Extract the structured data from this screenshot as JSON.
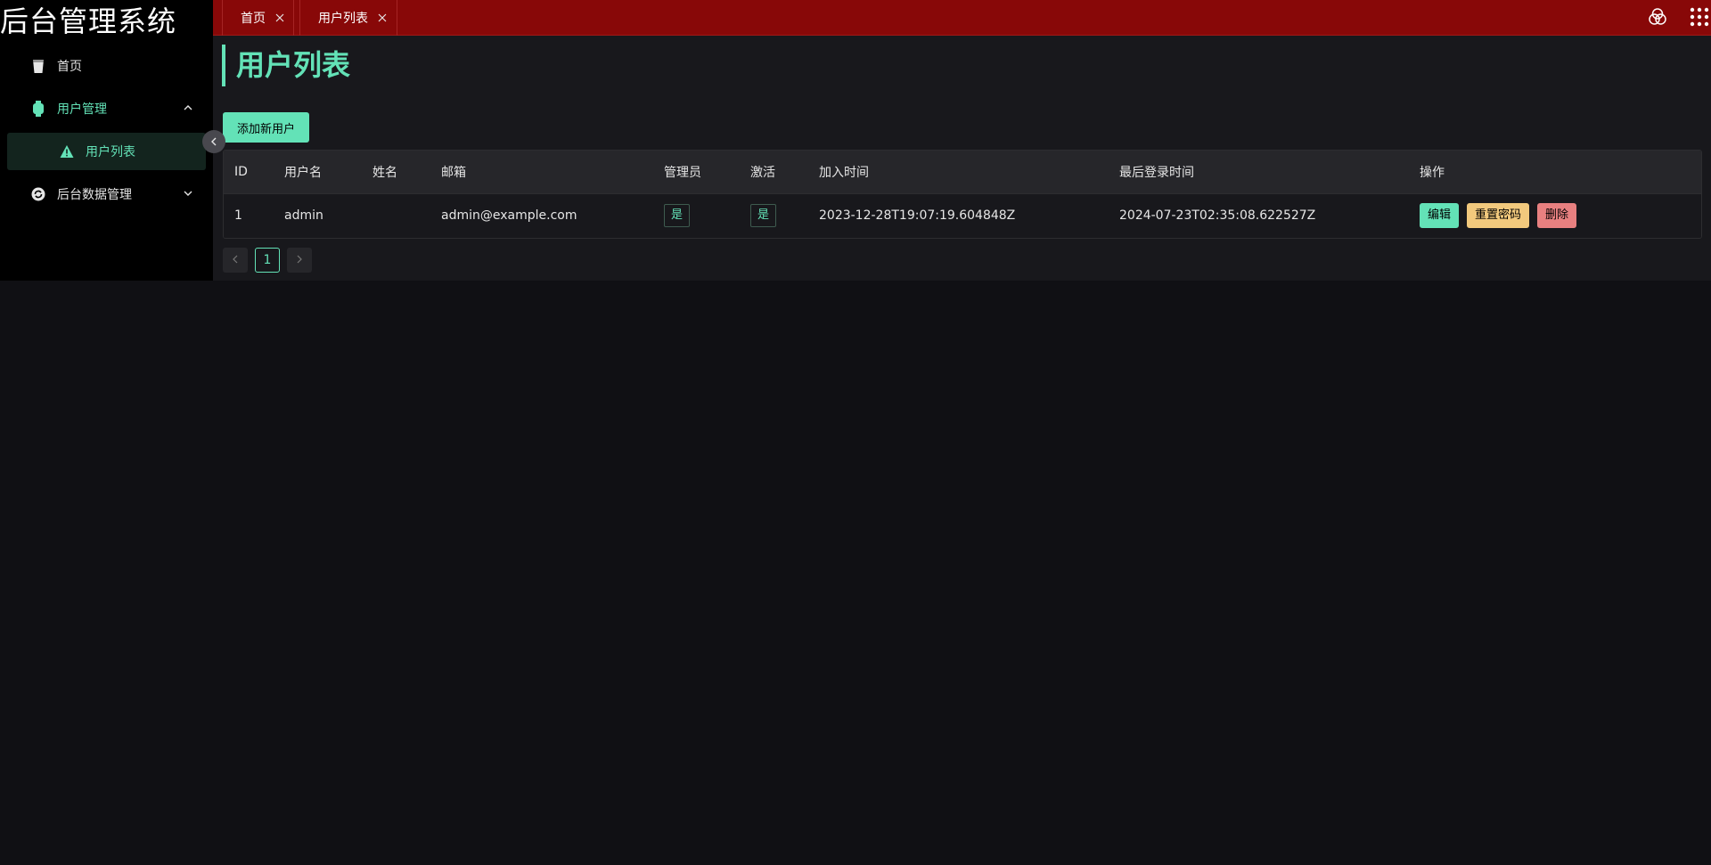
{
  "sidebar": {
    "brand": "后台管理系统",
    "items": [
      {
        "label": "首页",
        "icon": "cup-icon"
      },
      {
        "label": "用户管理",
        "icon": "watch-icon"
      },
      {
        "label": "用户列表",
        "icon": "warning-icon"
      },
      {
        "label": "后台数据管理",
        "icon": "sync-icon"
      }
    ]
  },
  "tabs": [
    {
      "label": "首页"
    },
    {
      "label": "用户列表"
    }
  ],
  "page": {
    "title": "用户列表",
    "add_button": "添加新用户"
  },
  "table": {
    "columns": [
      "ID",
      "用户名",
      "姓名",
      "邮箱",
      "管理员",
      "激活",
      "加入时间",
      "最后登录时间",
      "操作"
    ],
    "rows": [
      {
        "id": "1",
        "username": "admin",
        "name": "",
        "email": "admin@example.com",
        "is_admin": "是",
        "is_active": "是",
        "joined": "2023-12-28T19:07:19.604848Z",
        "last_login": "2024-07-23T02:35:08.622527Z",
        "actions": {
          "edit": "编辑",
          "reset": "重置密码",
          "delete": "删除"
        }
      }
    ]
  },
  "pagination": {
    "current": "1"
  },
  "colors": {
    "accent": "#63e2b7",
    "topbar": "#880808",
    "sidebar": "#000000",
    "warning": "#f2c97d",
    "danger": "#e88080"
  }
}
